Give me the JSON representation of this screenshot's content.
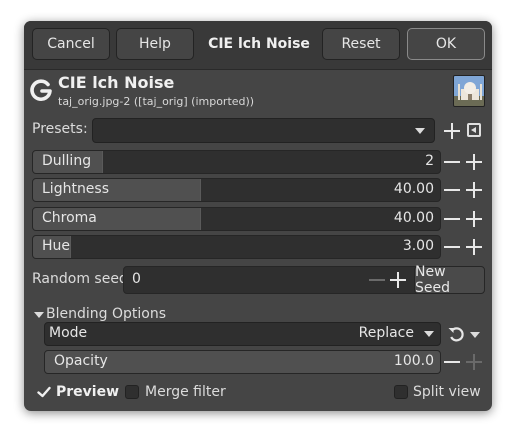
{
  "header": {
    "cancel_label": "Cancel",
    "help_label": "Help",
    "title": "CIE lch Noise",
    "reset_label": "Reset",
    "ok_label": "OK"
  },
  "filter": {
    "name": "CIE lch Noise",
    "subtitle": "taj_orig.jpg-2 ([taj_orig] (imported))",
    "logo_glyph": "G"
  },
  "presets": {
    "label": "Presets:",
    "value": ""
  },
  "sliders": [
    {
      "label": "Dulling",
      "value": "2",
      "fill": 0.17
    },
    {
      "label": "Lightness",
      "value": "40.00",
      "fill": 0.41
    },
    {
      "label": "Chroma",
      "value": "40.00",
      "fill": 0.41
    },
    {
      "label": "Hue",
      "value": "3.00",
      "fill": 0.09
    }
  ],
  "seed": {
    "label": "Random seed",
    "value": "0",
    "new_seed_label": "New Seed"
  },
  "blending": {
    "section_label": "Blending Options",
    "mode_label": "Mode",
    "mode_value": "Replace",
    "opacity_label": "Opacity",
    "opacity_value": "100.0",
    "opacity_fill": 1.0
  },
  "footer": {
    "preview_label": "Preview",
    "preview_checked": true,
    "merge_label": "Merge filter",
    "merge_checked": false,
    "split_label": "Split view",
    "split_checked": false
  },
  "colors": {
    "dialog_bg": "#454545",
    "header_bg": "#393939",
    "field_bg": "#2f2f2f",
    "slider_fill": "#505050"
  }
}
